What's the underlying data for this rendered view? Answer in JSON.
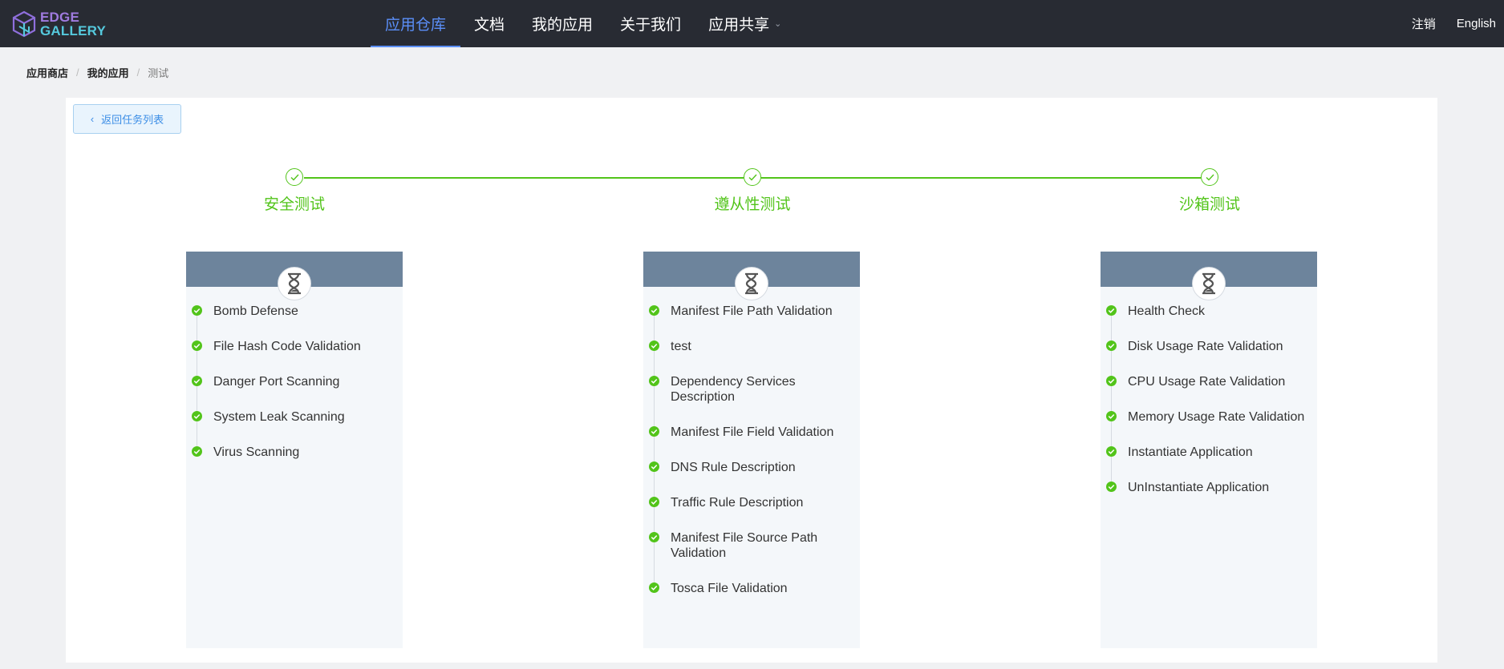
{
  "header": {
    "logo": {
      "line1": "EDGE",
      "line2": "GALLERY"
    },
    "nav": [
      {
        "label": "应用仓库",
        "active": true
      },
      {
        "label": "文档",
        "active": false
      },
      {
        "label": "我的应用",
        "active": false
      },
      {
        "label": "关于我们",
        "active": false
      },
      {
        "label": "应用共享",
        "active": false,
        "has_dropdown": true
      }
    ],
    "logout": "注销",
    "language": "English"
  },
  "breadcrumb": [
    "应用商店",
    "我的应用",
    "测试"
  ],
  "back_button": "返回任务列表",
  "steps": [
    {
      "title": "安全测试",
      "status": "done"
    },
    {
      "title": "遵从性测试",
      "status": "done"
    },
    {
      "title": "沙箱测试",
      "status": "done"
    }
  ],
  "columns": [
    {
      "status_icon": "hourglass-icon",
      "items": [
        "Bomb Defense",
        "File Hash Code Validation",
        "Danger Port Scanning",
        "System Leak Scanning",
        "Virus Scanning"
      ]
    },
    {
      "status_icon": "hourglass-icon",
      "items": [
        "Manifest File Path Validation",
        "test",
        "Dependency Services Description",
        "Manifest File Field Validation",
        "DNS Rule Description",
        "Traffic Rule Description",
        "Manifest File Source Path Validation",
        "Tosca File Validation"
      ]
    },
    {
      "status_icon": "hourglass-icon",
      "items": [
        "Health Check",
        "Disk Usage Rate Validation",
        "CPU Usage Rate Validation",
        "Memory Usage Rate Validation",
        "Instantiate Application",
        "UnInstantiate Application"
      ]
    }
  ],
  "colors": {
    "header_bg": "#282b33",
    "nav_active": "#5b8ff9",
    "success": "#52c41a",
    "column_head": "#6d849c",
    "column_bg": "#f4f7fa"
  }
}
